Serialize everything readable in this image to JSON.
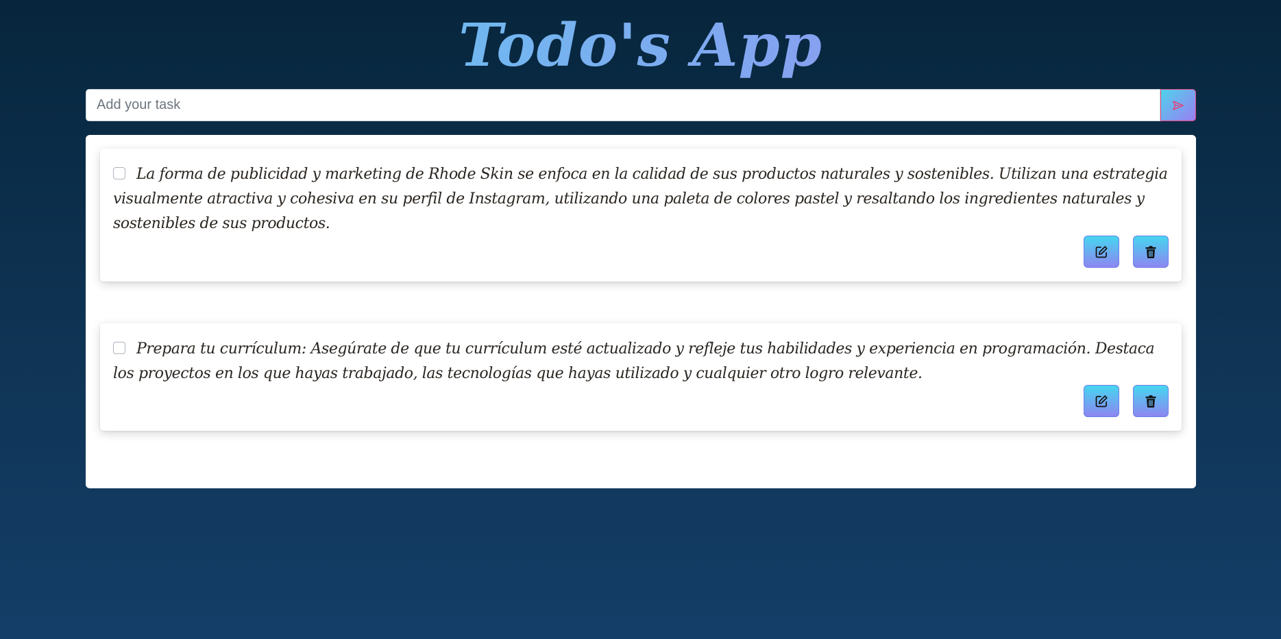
{
  "app": {
    "title": "Todo's App"
  },
  "form": {
    "input_value": "",
    "input_placeholder": "Add your task",
    "submit_icon": "send-icon"
  },
  "tasks": [
    {
      "text": "La forma de publicidad y marketing de Rhode Skin se enfoca en la calidad de sus productos naturales y sostenibles. Utilizan una estrategia visualmente atractiva y cohesiva en su perfil de Instagram, utilizando una paleta de colores pastel y resaltando los ingredientes naturales y sostenibles de sus productos.",
      "completed": false,
      "edit_icon": "edit-icon",
      "delete_icon": "trash-icon"
    },
    {
      "text": "Prepara tu currículum: Asegúrate de que tu currículum esté actualizado y refleje tus habilidades y experiencia en programación. Destaca los proyectos en los que hayas trabajado, las tecnologías que hayas utilizado y cualquier otro logro relevante.",
      "completed": false,
      "edit_icon": "edit-icon",
      "delete_icon": "trash-icon"
    }
  ],
  "colors": {
    "background_top": "#07263d",
    "background_bottom": "#143e68",
    "accent_cyan": "#46d6ef",
    "accent_violet": "#8d86f1",
    "send_icon": "#e0457b",
    "task_text": "#2a2520"
  }
}
